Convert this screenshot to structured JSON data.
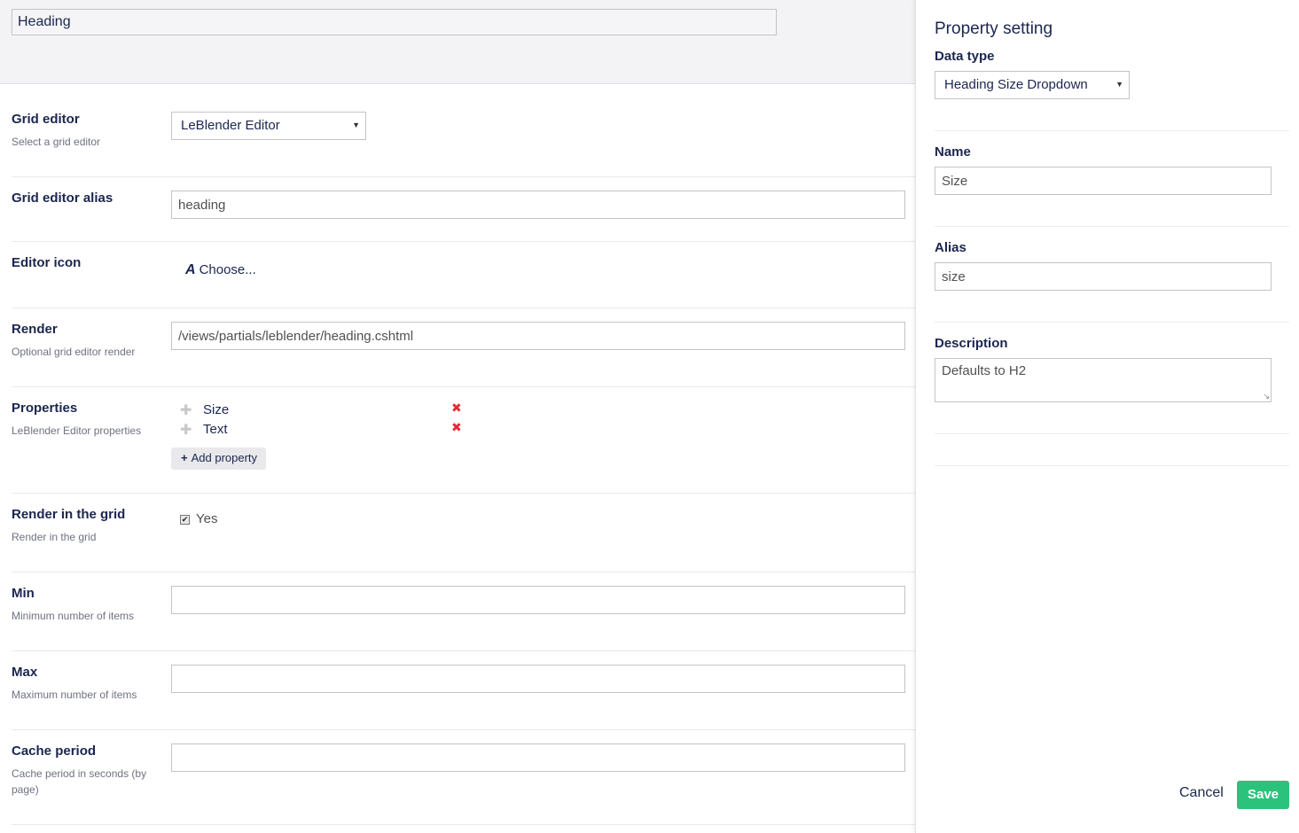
{
  "main": {
    "name_value": "Heading",
    "grid_editor": {
      "label": "Grid editor",
      "desc": "Select a grid editor",
      "selected": "LeBlender Editor"
    },
    "grid_editor_alias": {
      "label": "Grid editor alias",
      "value": "heading"
    },
    "editor_icon": {
      "label": "Editor icon",
      "icon_glyph": "A",
      "icon": "font-icon",
      "choose": "Choose..."
    },
    "render": {
      "label": "Render",
      "desc": "Optional grid editor render",
      "value": "/views/partials/leblender/heading.cshtml"
    },
    "properties": {
      "label": "Properties",
      "desc": "LeBlender Editor properties",
      "items": [
        {
          "label": "Size"
        },
        {
          "label": "Text"
        }
      ],
      "add_label": "Add property"
    },
    "render_in_grid": {
      "label": "Render in the grid",
      "desc": "Render in the grid",
      "checkbox_label": "Yes",
      "checked": true
    },
    "min": {
      "label": "Min",
      "desc": "Minimum number of items",
      "value": ""
    },
    "max": {
      "label": "Max",
      "desc": "Maximum number of items",
      "value": ""
    },
    "cache_period": {
      "label": "Cache period",
      "desc": "Cache period in seconds (by page)",
      "value": ""
    }
  },
  "overlay": {
    "title": "Property setting",
    "data_type": {
      "label": "Data type",
      "selected": "Heading Size Dropdown"
    },
    "name": {
      "label": "Name",
      "value": "Size"
    },
    "alias": {
      "label": "Alias",
      "value": "size"
    },
    "description": {
      "label": "Description",
      "value": "Defaults to H2"
    },
    "cancel_label": "Cancel",
    "save_label": "Save"
  },
  "colors": {
    "save_button": "#2bc37c",
    "remove_icon": "#e22c3c",
    "text": "#1b264f"
  }
}
